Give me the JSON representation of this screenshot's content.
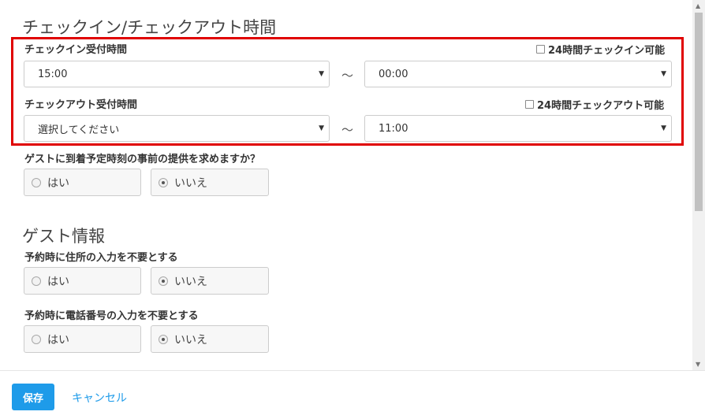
{
  "checkin_section": {
    "title": "チェックイン/チェックアウト時間",
    "checkin": {
      "label": "チェックイン受付時間",
      "checkbox_label": "24時間チェックイン可能",
      "from_value": "15:00",
      "to_value": "00:00"
    },
    "checkout": {
      "label": "チェックアウト受付時間",
      "checkbox_label": "24時間チェックアウト可能",
      "from_value": "選択してください",
      "to_value": "11:00"
    },
    "separator": "〜",
    "arrival_question": {
      "label": "ゲストに到着予定時刻の事前の提供を求めますか？",
      "yes": "はい",
      "no": "いいえ",
      "selected": "no"
    }
  },
  "guest_section": {
    "title": "ゲスト情報",
    "address_question": {
      "label": "予約時に住所の入力を不要とする",
      "yes": "はい",
      "no": "いいえ",
      "selected": "no"
    },
    "phone_question": {
      "label": "予約時に電話番号の入力を不要とする",
      "yes": "はい",
      "no": "いいえ",
      "selected": "no"
    }
  },
  "footer": {
    "save_label": "保存",
    "cancel_label": "キャンセル"
  },
  "colors": {
    "accent": "#1e9be9",
    "highlight": "#e00000"
  },
  "icons": {
    "dropdown": "triangle-down-icon",
    "scroll_up": "triangle-up-icon",
    "scroll_down": "triangle-down-icon"
  }
}
